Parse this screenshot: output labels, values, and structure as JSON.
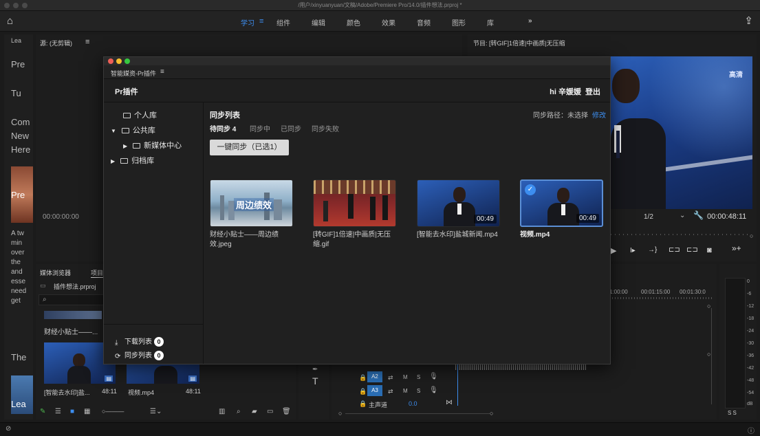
{
  "window": {
    "path": "/用户/xinyuanyuan/文稿/Adobe/Premiere Pro/14.0/插件想法.prproj *"
  },
  "menubar": {
    "items": [
      "学习",
      "组件",
      "编辑",
      "颜色",
      "效果",
      "音频",
      "图形",
      "库"
    ],
    "active": "学习",
    "more": "»"
  },
  "learn_panel": {
    "tab": "Lea",
    "texts": [
      "Pre",
      "Tu",
      "Com",
      "New",
      "Here",
      "Pre",
      "A tw",
      "min",
      "over",
      "the",
      "and",
      "esse",
      "need",
      "get",
      "The",
      "Lea"
    ]
  },
  "source_panel": {
    "title": "源: (无剪辑)",
    "timecode": "00:00:00:00"
  },
  "program_panel": {
    "title": "节目: [转GIF]1倍速|中画质|无压缩",
    "zoom": "1/2",
    "timecode": "00:00:48:11",
    "video_badge": "高清"
  },
  "project_panel": {
    "tabs": [
      "媒体浏览器",
      "项目"
    ],
    "file": "插件想法.prproj",
    "item1_name": "财经小贴士——...",
    "clips": [
      {
        "name": "[智能去水印]盐...",
        "duration": "48:11"
      },
      {
        "name": "视频.mp4",
        "duration": "48:11"
      }
    ]
  },
  "timeline": {
    "ticks": [
      "1:00:00",
      "00:01:15:00",
      "00:01:30:0"
    ],
    "tracks": [
      {
        "label": "A2",
        "m": "M",
        "s": "S"
      },
      {
        "label": "A3",
        "m": "M",
        "s": "S"
      }
    ],
    "master_label": "主声道",
    "master_value": "0.0"
  },
  "meter": {
    "scale": [
      "0",
      "-6",
      "-12",
      "-18",
      "-24",
      "-30",
      "-36",
      "-42",
      "-48",
      "-54",
      "dB"
    ],
    "channels": "S S"
  },
  "plugin": {
    "tab_title": "智能媒资-Pr插件",
    "header_title": "Pr插件",
    "user_greeting": "hi 辛媛媛",
    "logout": "登出",
    "tree": {
      "personal": "个人库",
      "public": "公共库",
      "newmedia": "新媒体中心",
      "archive": "归档库"
    },
    "download_list": "下载列表",
    "download_count": "0",
    "sync_list_label": "同步列表",
    "sync_count": "0",
    "content_title": "同步列表",
    "sync_path_label": "同步路径：未选择",
    "sync_path_edit": "修改",
    "tabs": [
      {
        "label": "待同步 4",
        "active": true
      },
      {
        "label": "同步中",
        "active": false
      },
      {
        "label": "已同步",
        "active": false
      },
      {
        "label": "同步失败",
        "active": false
      }
    ],
    "sync_button": "一键同步（已选1）",
    "items": [
      {
        "caption": "财经小贴士——周边绩效.jpeg",
        "overlay": "周边绩效",
        "duration": "",
        "selected": false,
        "kind": "city"
      },
      {
        "caption": "[转GIF]1倍速|中画质|无压缩.gif",
        "overlay": "",
        "duration": "",
        "selected": false,
        "kind": "hall"
      },
      {
        "caption": "[智能去水印]盐城新闻.mp4",
        "overlay": "",
        "duration": "00:49",
        "selected": false,
        "kind": "anchor"
      },
      {
        "caption": "视频.mp4",
        "overlay": "",
        "duration": "00:49",
        "selected": true,
        "kind": "anchor"
      }
    ]
  }
}
